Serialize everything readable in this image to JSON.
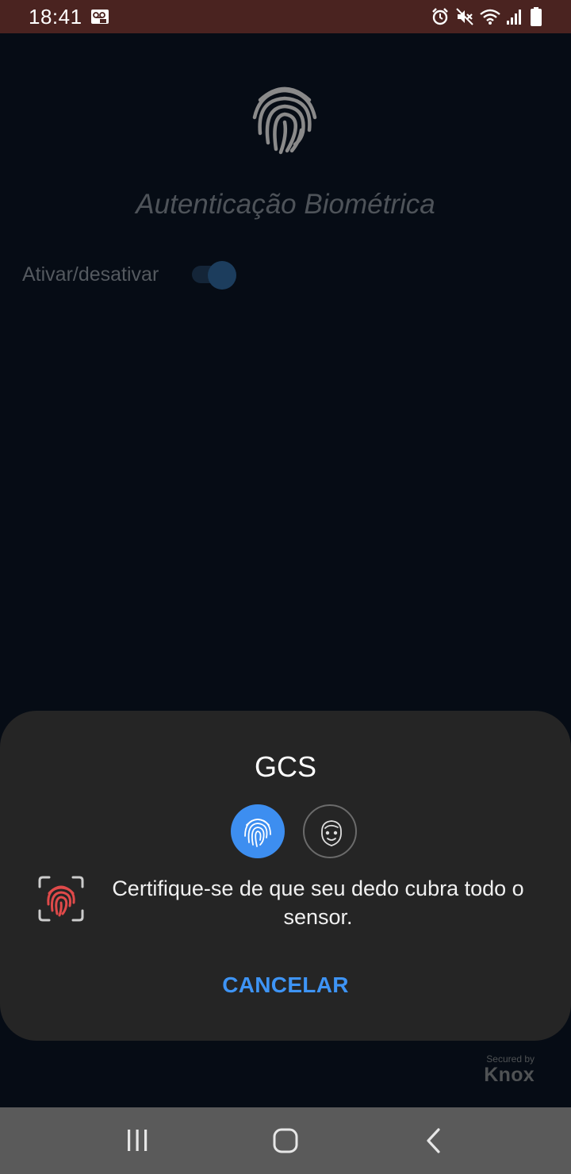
{
  "status_bar": {
    "time": "18:41",
    "icons": [
      "voicemail-icon",
      "alarm-icon",
      "mute-icon",
      "wifi-icon",
      "signal-icon",
      "battery-icon"
    ]
  },
  "app": {
    "title": "Autenticação Biométrica",
    "toggle_label": "Ativar/desativar",
    "toggle_on": true,
    "hero_icon": "fingerprint-icon"
  },
  "dialog": {
    "title": "GCS",
    "methods": [
      {
        "icon": "fingerprint-icon",
        "selected": true
      },
      {
        "icon": "face-icon",
        "selected": false
      }
    ],
    "message": "Certifique-se de que seu dedo cubra todo o sensor.",
    "status_icon": "fingerprint-scan-error-icon",
    "cancel_label": "CANCELAR"
  },
  "branding": {
    "secured_by": "Secured by",
    "knox": "Knox"
  },
  "nav_bar": {
    "buttons": [
      "recent-apps-icon",
      "home-icon",
      "back-icon"
    ]
  },
  "colors": {
    "status_bar_bg": "#4a2320",
    "app_bg": "#060c15",
    "dialog_bg": "#252525",
    "accent": "#3d8ef0",
    "error": "#e04a4a",
    "nav_bar_bg": "#5a5a5a"
  }
}
